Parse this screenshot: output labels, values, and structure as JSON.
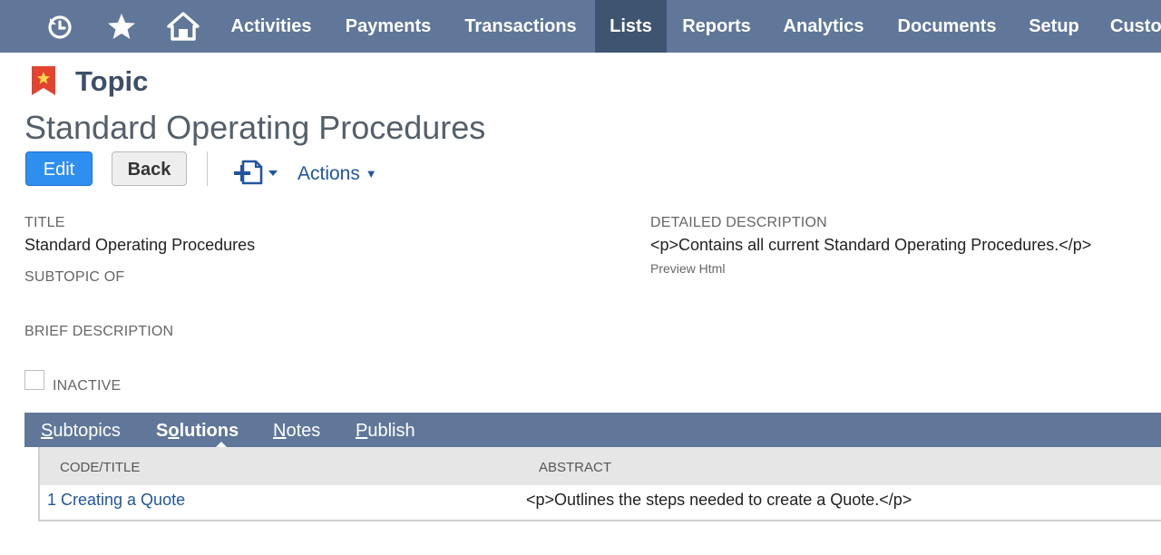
{
  "nav": {
    "items": [
      {
        "label": "Activities"
      },
      {
        "label": "Payments"
      },
      {
        "label": "Transactions"
      },
      {
        "label": "Lists"
      },
      {
        "label": "Reports"
      },
      {
        "label": "Analytics"
      },
      {
        "label": "Documents"
      },
      {
        "label": "Setup"
      },
      {
        "label": "Custo"
      }
    ],
    "active": "Lists",
    "icons": [
      "recent-history-icon",
      "star-icon",
      "home-icon"
    ]
  },
  "header": {
    "record_type": "Topic",
    "title": "Standard Operating Procedures"
  },
  "toolbar": {
    "edit_label": "Edit",
    "back_label": "Back",
    "actions_label": "Actions"
  },
  "fields": {
    "title_label": "TITLE",
    "title_value": "Standard Operating Procedures",
    "subtopic_label": "SUBTOPIC OF",
    "brief_label": "BRIEF DESCRIPTION",
    "inactive_label": "INACTIVE",
    "detailed_label": "DETAILED DESCRIPTION",
    "detailed_value": "<p>Contains all current Standard Operating Procedures.</p>",
    "preview_label": "Preview Html"
  },
  "tabs": {
    "subtopics": {
      "u": "S",
      "rest": "ubtopics"
    },
    "solutions": {
      "pre": "S",
      "u": "o",
      "rest": "lutions"
    },
    "notes": {
      "u": "N",
      "rest": "otes"
    },
    "publish": {
      "u": "P",
      "rest": "ublish"
    },
    "active": "Solutions"
  },
  "table": {
    "columns": [
      "CODE/TITLE",
      "ABSTRACT"
    ],
    "rows": [
      {
        "code_title": "1 Creating a Quote",
        "abstract": "<p>Outlines the steps needed to create a Quote.</p>"
      }
    ]
  },
  "colors": {
    "nav_bg": "#607799",
    "nav_active": "#3e5470",
    "primary_button": "#2f8ff0",
    "link": "#21569e",
    "record_icon": "#e2442f"
  }
}
